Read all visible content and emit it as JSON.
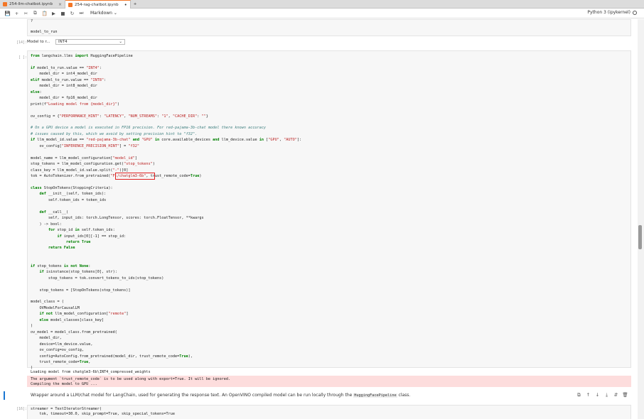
{
  "tabs": [
    {
      "label": "254-llm-chatbot.ipynb",
      "active": false
    },
    {
      "label": "254-rag-chatbot.ipynb",
      "active": true
    }
  ],
  "toolbar": {
    "save": "💾",
    "add": "+",
    "cut": "✂",
    "copy": "⧉",
    "paste": "📋",
    "run": "▶",
    "stop": "■",
    "restart": "↻",
    "fastforward": "⏭",
    "cell_type": "Markdown",
    "cell_type_arrow": "⌄"
  },
  "kernel": {
    "name": "Python 3 (ipykernel)"
  },
  "cells": {
    "top_fragment": "?",
    "model_to_run_line": "model_to_run",
    "prompt_14": "[14]:",
    "widget": {
      "label": "Model to r...",
      "value": "INT4",
      "arrow": "⌄"
    },
    "prompt_code": "[ ]:",
    "prompt_last": "[16]:"
  },
  "code": [
    "from langchain.llms import HuggingFacePipeline",
    "",
    "if model_to_run.value == \"INT4\":",
    "    model_dir = int4_model_dir",
    "elif model_to_run.value == \"INT8\":",
    "    model_dir = int8_model_dir",
    "else:",
    "    model_dir = fp16_model_dir",
    "print(f\"Loading model from {model_dir}\")",
    "",
    "ov_config = {\"PERFORMANCE_HINT\": \"LATENCY\", \"NUM_STREAMS\": \"1\", \"CACHE_DIR\": \"\"}",
    "",
    "# On a GPU device a model is executed in FP16 precision. For red-pajama-3b-chat model there known accuracy",
    "# issues caused by this, which we avoid by setting precision hint to \"f32\".",
    "if llm_model_id.value == \"red-pajama-3b-chat\" and \"GPU\" in core.available_devices and llm_device.value in [\"GPU\", \"AUTO\"]:",
    "    ov_config[\"INFERENCE_PRECISION_HINT\"] = \"f32\"",
    "",
    "model_name = llm_model_configuration[\"model_id\"]",
    "stop_tokens = llm_model_configuration.get(\"stop_tokens\")",
    "class_key = llm_model_id.value.split(\"-\")[0]",
    "tok = AutoTokenizer.from_pretrained(\"F:/chatglm3-6b\", trust_remote_code=True)",
    "",
    "class StopOnTokens(StoppingCriteria):",
    "    def __init__(self, token_ids):",
    "        self.token_ids = token_ids",
    "",
    "    def __call__(",
    "        self, input_ids: torch.LongTensor, scores: torch.FloatTensor, **kwargs",
    "    ) -> bool:",
    "        for stop_id in self.token_ids:",
    "            if input_ids[0][-1] == stop_id:",
    "                return True",
    "        return False",
    "",
    "",
    "if stop_tokens is not None:",
    "    if isinstance(stop_tokens[0], str):",
    "        stop_tokens = tok.convert_tokens_to_ids(stop_tokens)",
    "",
    "    stop_tokens = [StopOnTokens(stop_tokens)]",
    "",
    "model_class = (",
    "    OVModelForCausalLM",
    "    if not llm_model_configuration[\"remote\"]",
    "    else model_classes[class_key]",
    ")",
    "ov_model = model_class.from_pretrained(",
    "    model_dir,",
    "    device=llm_device.value,",
    "    ov_config=ov_config,",
    "    config=AutoConfig.from_pretrained(model_dir, trust_remote_code=True),",
    "    trust_remote_code=True,",
    ")"
  ],
  "outputs": {
    "stdout": "Loading model from chatglm3-6b\\INT4_compressed_weights",
    "stderr": [
      "The argument `trust_remote_code` is to be used along with export=True. It will be ignored.",
      "Compiling the model to GPU ..."
    ]
  },
  "markdown": {
    "text_before": "Wrapper around a LLM/chat model for LangChain, used for generating the response text. An OpenVINO compiled model can be run locally through the ",
    "code": "HuggingFacePipeline",
    "text_after": " class."
  },
  "cell_tools": {
    "copy": "⧉",
    "up": "↑",
    "down": "↓",
    "save": "⤓",
    "merge": "⇵",
    "delete": "🗑"
  },
  "last_code": [
    "streamer = TextIteratorStreamer(",
    "    tok, timeout=30.0, skip_prompt=True, skip_special_tokens=True"
  ],
  "colors": {
    "accent": "#f37626",
    "highlight_box": "#e02020",
    "stderr_bg": "#fddddd",
    "active_cell_bar": "#1976d2"
  }
}
